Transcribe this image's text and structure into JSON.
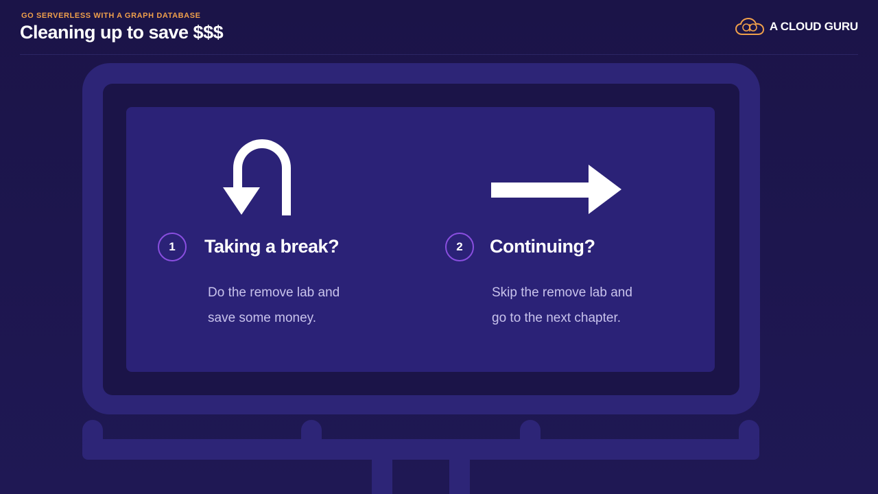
{
  "header": {
    "course_label": "GO SERVERLESS WITH A GRAPH DATABASE",
    "title": "Cleaning up to save $$$"
  },
  "brand": {
    "name": "A CLOUD GURU",
    "logo_icon": "cloud-logo-icon",
    "accent_color": "#f0a04b"
  },
  "options": [
    {
      "number": "1",
      "icon": "u-turn-arrow-icon",
      "heading": "Taking a break?",
      "description_line1": "Do the remove lab and",
      "description_line2": "save some money."
    },
    {
      "number": "2",
      "icon": "right-arrow-icon",
      "heading": "Continuing?",
      "description_line1": "Skip the remove lab and",
      "description_line2": "go to the next chapter."
    }
  ],
  "colors": {
    "background": "#1b1448",
    "billboard": "#2d2577",
    "panel": "#2b2277",
    "badge_ring": "#8a4fe0"
  }
}
